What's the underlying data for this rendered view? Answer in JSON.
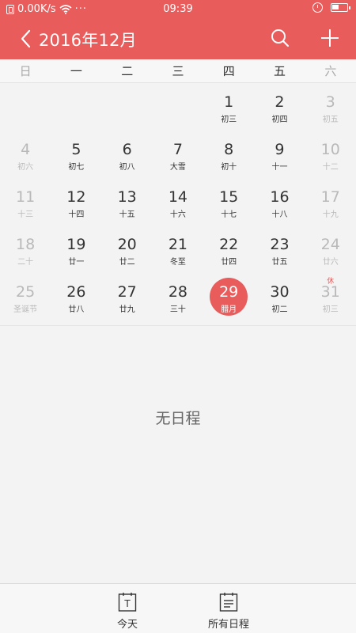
{
  "status": {
    "speed": "0.00K/s",
    "dots": "···",
    "time": "09:39"
  },
  "header": {
    "title": "2016年12月"
  },
  "weekdays": [
    "日",
    "一",
    "二",
    "三",
    "四",
    "五",
    "六"
  ],
  "weeks": [
    [
      {
        "day": "",
        "lunar": ""
      },
      {
        "day": "",
        "lunar": ""
      },
      {
        "day": "",
        "lunar": ""
      },
      {
        "day": "",
        "lunar": ""
      },
      {
        "day": "1",
        "lunar": "初三"
      },
      {
        "day": "2",
        "lunar": "初四"
      },
      {
        "day": "3",
        "lunar": "初五"
      }
    ],
    [
      {
        "day": "4",
        "lunar": "初六"
      },
      {
        "day": "5",
        "lunar": "初七"
      },
      {
        "day": "6",
        "lunar": "初八"
      },
      {
        "day": "7",
        "lunar": "大雪"
      },
      {
        "day": "8",
        "lunar": "初十"
      },
      {
        "day": "9",
        "lunar": "十一"
      },
      {
        "day": "10",
        "lunar": "十二"
      }
    ],
    [
      {
        "day": "11",
        "lunar": "十三"
      },
      {
        "day": "12",
        "lunar": "十四"
      },
      {
        "day": "13",
        "lunar": "十五"
      },
      {
        "day": "14",
        "lunar": "十六"
      },
      {
        "day": "15",
        "lunar": "十七"
      },
      {
        "day": "16",
        "lunar": "十八"
      },
      {
        "day": "17",
        "lunar": "十九"
      }
    ],
    [
      {
        "day": "18",
        "lunar": "二十"
      },
      {
        "day": "19",
        "lunar": "廿一"
      },
      {
        "day": "20",
        "lunar": "廿二"
      },
      {
        "day": "21",
        "lunar": "冬至"
      },
      {
        "day": "22",
        "lunar": "廿四"
      },
      {
        "day": "23",
        "lunar": "廿五"
      },
      {
        "day": "24",
        "lunar": "廿六"
      }
    ],
    [
      {
        "day": "25",
        "lunar": "圣诞节"
      },
      {
        "day": "26",
        "lunar": "廿八"
      },
      {
        "day": "27",
        "lunar": "廿九"
      },
      {
        "day": "28",
        "lunar": "三十"
      },
      {
        "day": "29",
        "lunar": "腊月",
        "today": true
      },
      {
        "day": "30",
        "lunar": "初二"
      },
      {
        "day": "31",
        "lunar": "初三",
        "holiday": "休"
      }
    ]
  ],
  "empty_text": "无日程",
  "bottom_tabs": {
    "today_label": "今天",
    "today_icon_letter": "T",
    "all_label": "所有日程"
  },
  "colors": {
    "accent": "#e85c5c",
    "dim_text": "#b9b9b9"
  }
}
